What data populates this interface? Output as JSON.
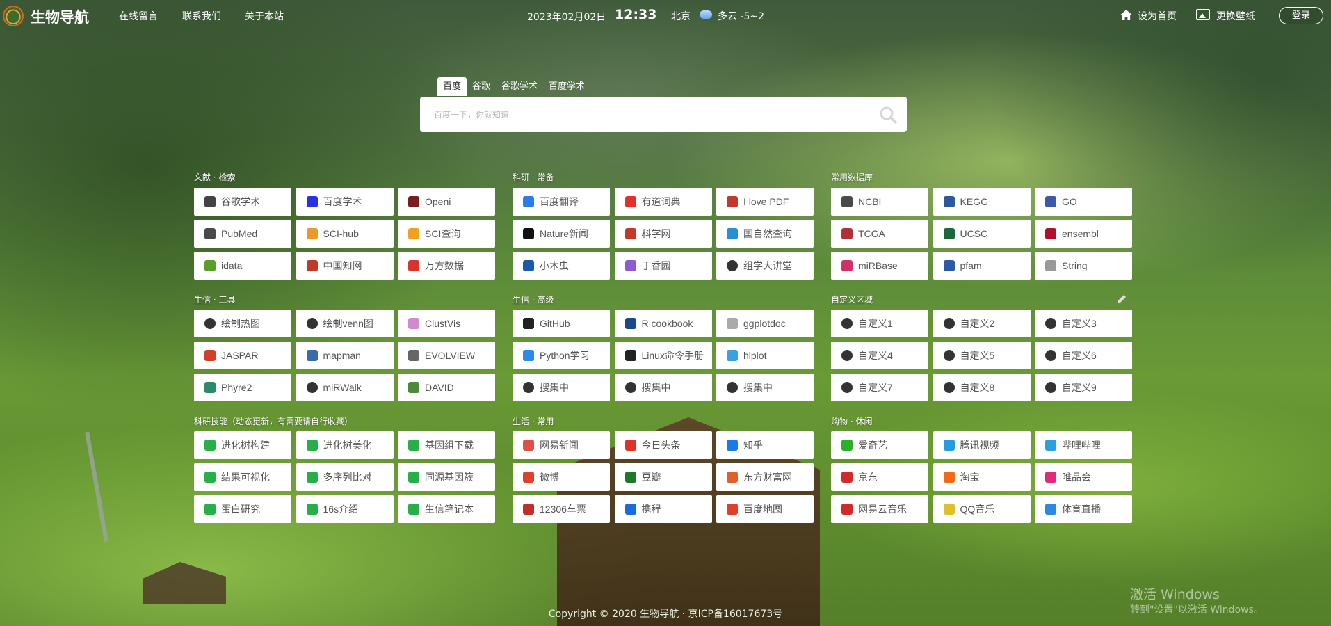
{
  "header": {
    "site_title": "生物导航",
    "nav": [
      "在线留言",
      "联系我们",
      "关于本站"
    ],
    "date": "2023年02月02日",
    "time": "12:33",
    "city": "北京",
    "weather": "多云 -5~2",
    "set_home": "设为首页",
    "change_wallpaper": "更换壁纸",
    "login": "登录"
  },
  "search": {
    "tabs": [
      "百度",
      "谷歌",
      "谷歌学术",
      "百度学术"
    ],
    "active_tab": "百度",
    "placeholder": "百度一下，你就知道"
  },
  "sections": [
    {
      "title": "文献 · 检索",
      "items": [
        {
          "label": "谷歌学术",
          "icon": "panda-icon",
          "color": "#444"
        },
        {
          "label": "百度学术",
          "icon": "baidu-paw-icon",
          "color": "#2932e1"
        },
        {
          "label": "Openi",
          "icon": "openi-book-icon",
          "color": "#7a1f1f"
        },
        {
          "label": "PubMed",
          "icon": "pubmed-arrow-icon",
          "color": "#4a4a4a"
        },
        {
          "label": "SCI-hub",
          "icon": "scihub-bird-icon",
          "color": "#e89a2a"
        },
        {
          "label": "SCI查询",
          "icon": "sci-query-coin-icon",
          "color": "#f0a020"
        },
        {
          "label": "idata",
          "icon": "idata-icon",
          "color": "#5a9e2a"
        },
        {
          "label": "中国知网",
          "icon": "cnki-icon",
          "color": "#c0392b"
        },
        {
          "label": "万方数据",
          "icon": "wanfang-icon",
          "color": "#d9342b"
        }
      ]
    },
    {
      "title": "科研 · 常备",
      "items": [
        {
          "label": "百度翻译",
          "icon": "baidu-translate-icon",
          "color": "#2b7be8"
        },
        {
          "label": "有道词典",
          "icon": "youdao-icon",
          "color": "#e0322a"
        },
        {
          "label": "I love PDF",
          "icon": "ilovepdf-icon",
          "color": "#c0392b"
        },
        {
          "label": "Nature新闻",
          "icon": "nature-icon",
          "color": "#111"
        },
        {
          "label": "科学网",
          "icon": "sciencenet-icon",
          "color": "#c0392b"
        },
        {
          "label": "国自然查询",
          "icon": "nsfc-globe-icon",
          "color": "#2a8fd0"
        },
        {
          "label": "小木虫",
          "icon": "muchong-icon",
          "color": "#1a5aa8"
        },
        {
          "label": "丁香园",
          "icon": "dxy-icon",
          "color": "#8e5ad0"
        },
        {
          "label": "组学大讲堂",
          "icon": "globe-icon",
          "color": "#333"
        }
      ]
    },
    {
      "title": "常用数据库",
      "items": [
        {
          "label": "NCBI",
          "icon": "ncbi-icon",
          "color": "#4a4a4a"
        },
        {
          "label": "KEGG",
          "icon": "kegg-icon",
          "color": "#2a5a9a"
        },
        {
          "label": "GO",
          "icon": "go-icon",
          "color": "#3a5aa8"
        },
        {
          "label": "TCGA",
          "icon": "tcga-icon",
          "color": "#b0303a"
        },
        {
          "label": "UCSC",
          "icon": "ucsc-icon",
          "color": "#1a6a3a"
        },
        {
          "label": "ensembl",
          "icon": "ensembl-icon",
          "color": "#b01030"
        },
        {
          "label": "miRBase",
          "icon": "mirbase-icon",
          "color": "#d0306a"
        },
        {
          "label": "pfam",
          "icon": "pfam-icon",
          "color": "#2a5aa8"
        },
        {
          "label": "String",
          "icon": "string-icon",
          "color": "#999"
        }
      ]
    },
    {
      "title": "生信 · 工具",
      "items": [
        {
          "label": "绘制热图",
          "icon": "globe-icon",
          "color": "#333"
        },
        {
          "label": "绘制venn图",
          "icon": "globe-icon",
          "color": "#333"
        },
        {
          "label": "ClustVis",
          "icon": "clustvis-icon",
          "color": "#d08ad0"
        },
        {
          "label": "JASPAR",
          "icon": "jaspar-icon",
          "color": "#d0402a"
        },
        {
          "label": "mapman",
          "icon": "mapman-icon",
          "color": "#3a6aa8"
        },
        {
          "label": "EVOLVIEW",
          "icon": "cloud-outline-icon",
          "color": "#666"
        },
        {
          "label": "Phyre2",
          "icon": "phyre-icon",
          "color": "#2a8a6a"
        },
        {
          "label": "miRWalk",
          "icon": "globe-icon",
          "color": "#333"
        },
        {
          "label": "DAVID",
          "icon": "david-icon",
          "color": "#4a8a3a"
        }
      ]
    },
    {
      "title": "生信 · 高级",
      "items": [
        {
          "label": "GitHub",
          "icon": "github-icon",
          "color": "#222"
        },
        {
          "label": "R cookbook",
          "icon": "r-icon",
          "color": "#1a4a8a"
        },
        {
          "label": "ggplotdoc",
          "icon": "ggplot-icon",
          "color": "#aaa"
        },
        {
          "label": "Python学习",
          "icon": "rocket-icon",
          "color": "#2a8ae8"
        },
        {
          "label": "Linux命令手册",
          "icon": "penguin-icon",
          "color": "#222"
        },
        {
          "label": "hiplot",
          "icon": "hiplot-icon",
          "color": "#3aa0e0"
        },
        {
          "label": "搜集中",
          "icon": "globe-icon",
          "color": "#333"
        },
        {
          "label": "搜集中",
          "icon": "globe-icon",
          "color": "#333"
        },
        {
          "label": "搜集中",
          "icon": "globe-icon",
          "color": "#333"
        }
      ]
    },
    {
      "title": "自定义区域",
      "items": [
        {
          "label": "自定义1",
          "icon": "globe-icon",
          "color": "#333"
        },
        {
          "label": "自定义2",
          "icon": "globe-icon",
          "color": "#333"
        },
        {
          "label": "自定义3",
          "icon": "globe-icon",
          "color": "#333"
        },
        {
          "label": "自定义4",
          "icon": "globe-icon",
          "color": "#333"
        },
        {
          "label": "自定义5",
          "icon": "globe-icon",
          "color": "#333"
        },
        {
          "label": "自定义6",
          "icon": "globe-icon",
          "color": "#333"
        },
        {
          "label": "自定义7",
          "icon": "globe-icon",
          "color": "#333"
        },
        {
          "label": "自定义8",
          "icon": "globe-icon",
          "color": "#333"
        },
        {
          "label": "自定义9",
          "icon": "globe-icon",
          "color": "#333"
        }
      ]
    },
    {
      "title": "科研技能（动态更新，有需要请自行收藏）",
      "items": [
        {
          "label": "进化树构建",
          "icon": "wechat-icon",
          "color": "#2aae4a"
        },
        {
          "label": "进化树美化",
          "icon": "wechat-icon",
          "color": "#2aae4a"
        },
        {
          "label": "基因组下载",
          "icon": "wechat-icon",
          "color": "#2aae4a"
        },
        {
          "label": "结果可视化",
          "icon": "wechat-icon",
          "color": "#2aae4a"
        },
        {
          "label": "多序列比对",
          "icon": "wechat-icon",
          "color": "#2aae4a"
        },
        {
          "label": "同源基因簇",
          "icon": "wechat-icon",
          "color": "#2aae4a"
        },
        {
          "label": "蛋白研究",
          "icon": "wechat-icon",
          "color": "#2aae4a"
        },
        {
          "label": "16s介绍",
          "icon": "wechat-icon",
          "color": "#2aae4a"
        },
        {
          "label": "生信笔记本",
          "icon": "wechat-icon",
          "color": "#2aae4a"
        }
      ]
    },
    {
      "title": "生活 · 常用",
      "items": [
        {
          "label": "网易新闻",
          "icon": "netease-news-icon",
          "color": "#e0504a"
        },
        {
          "label": "今日头条",
          "icon": "toutiao-icon",
          "color": "#e0302a"
        },
        {
          "label": "知乎",
          "icon": "zhihu-icon",
          "color": "#1a7ae8"
        },
        {
          "label": "微博",
          "icon": "weibo-icon",
          "color": "#e0402a"
        },
        {
          "label": "豆瓣",
          "icon": "douban-icon",
          "color": "#1a7a2a"
        },
        {
          "label": "东方财富网",
          "icon": "eastmoney-icon",
          "color": "#e0602a"
        },
        {
          "label": "12306车票",
          "icon": "railway-icon",
          "color": "#c0302a"
        },
        {
          "label": "携程",
          "icon": "ctrip-icon",
          "color": "#1a6ae0"
        },
        {
          "label": "百度地图",
          "icon": "map-pin-icon",
          "color": "#e0402a"
        }
      ]
    },
    {
      "title": "购物 · 休闲",
      "items": [
        {
          "label": "爱奇艺",
          "icon": "iqiyi-icon",
          "color": "#2ab02a"
        },
        {
          "label": "腾讯视频",
          "icon": "tencent-video-icon",
          "color": "#2a9ae0"
        },
        {
          "label": "哔哩哔哩",
          "icon": "bilibili-icon",
          "color": "#2aa0e0"
        },
        {
          "label": "京东",
          "icon": "jd-icon",
          "color": "#d02a2a"
        },
        {
          "label": "淘宝",
          "icon": "taobao-icon",
          "color": "#f06a1a"
        },
        {
          "label": "唯品会",
          "icon": "vip-icon",
          "color": "#e02a7a"
        },
        {
          "label": "网易云音乐",
          "icon": "netease-music-icon",
          "color": "#d02a2a"
        },
        {
          "label": "QQ音乐",
          "icon": "qq-music-icon",
          "color": "#e0c02a"
        },
        {
          "label": "体育直播",
          "icon": "sports-icon",
          "color": "#2a8ae0"
        }
      ]
    }
  ],
  "footer": "Copyright © 2020 生物导航 · 京ICP备16017673号",
  "windows_watermark": {
    "line1": "激活 Windows",
    "line2": "转到\"设置\"以激活 Windows。"
  }
}
